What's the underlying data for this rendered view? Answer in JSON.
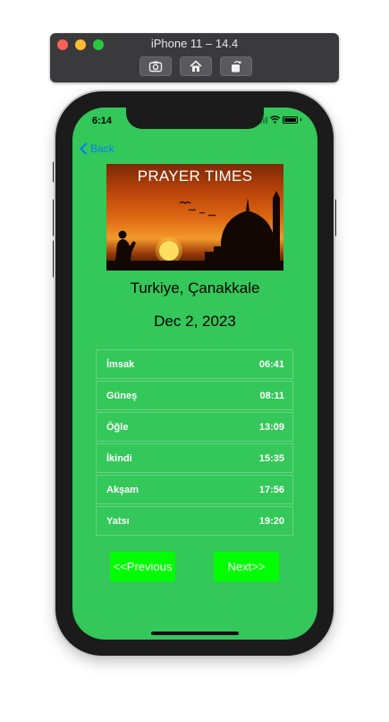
{
  "simulator": {
    "title": "iPhone 11 – 14.4",
    "buttons": [
      "screenshot-icon",
      "home-icon",
      "rotate-icon"
    ]
  },
  "status_bar": {
    "time": "6:14"
  },
  "nav": {
    "back_label": "Back"
  },
  "banner": {
    "title": "PRAYER TIMES"
  },
  "location": "Turkiye, Çanakkale",
  "date": "Dec 2, 2023",
  "prayer_times": [
    {
      "name": "İmsak",
      "time": "06:41"
    },
    {
      "name": "Güneş",
      "time": "08:11"
    },
    {
      "name": "Öğle",
      "time": "13:09"
    },
    {
      "name": "İkindi",
      "time": "15:35"
    },
    {
      "name": "Akşam",
      "time": "17:56"
    },
    {
      "name": "Yatsı",
      "time": "19:20"
    }
  ],
  "buttons": {
    "previous": "<<Previous",
    "next": "Next>>"
  },
  "colors": {
    "background": "#34c759",
    "button": "#00ff00",
    "back_link": "#0a7aff",
    "text_light": "#ffffff"
  }
}
